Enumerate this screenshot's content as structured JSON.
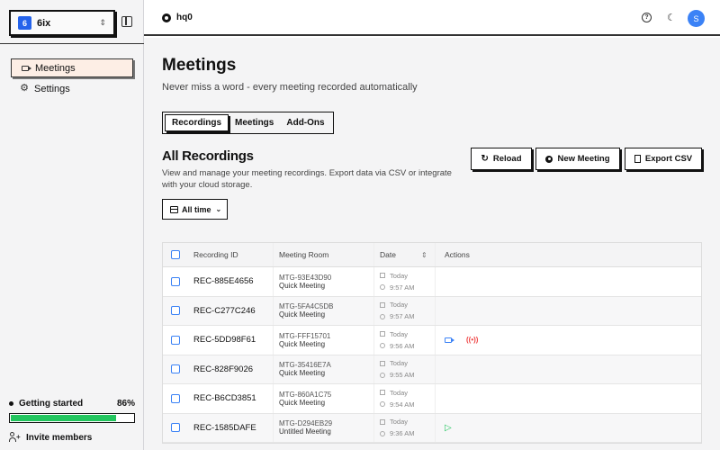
{
  "workspace": {
    "avatar": "6",
    "name": "6ix"
  },
  "sidebar": {
    "items": [
      {
        "label": "Meetings",
        "icon": "video-icon",
        "active": true
      },
      {
        "label": "Settings",
        "icon": "gear-icon",
        "active": false
      }
    ],
    "getting_started": {
      "label": "Getting started",
      "percent_label": "86%",
      "progress": 0.86
    },
    "invite_label": "Invite members"
  },
  "topbar": {
    "brand": "hq0",
    "user_initial": "S"
  },
  "page": {
    "title": "Meetings",
    "subtitle": "Never miss a word - every meeting recorded automatically"
  },
  "tabs": [
    {
      "label": "Recordings",
      "active": true
    },
    {
      "label": "Meetings",
      "active": false
    },
    {
      "label": "Add-Ons",
      "active": false
    }
  ],
  "section": {
    "title": "All Recordings",
    "description": "View and manage your meeting recordings. Export data via CSV or integrate with your cloud storage."
  },
  "toolbar": {
    "reload_label": "Reload",
    "new_meeting_label": "New Meeting",
    "export_label": "Export CSV"
  },
  "filter": {
    "label": "All time"
  },
  "table": {
    "headers": {
      "id": "Recording ID",
      "room": "Meeting Room",
      "date": "Date",
      "actions": "Actions"
    },
    "rows": [
      {
        "id": "REC-885E4656",
        "room_id": "MTG-93E43D90",
        "room_type": "Quick Meeting",
        "day": "Today",
        "time": "9:57 AM",
        "actions": []
      },
      {
        "id": "REC-C277C246",
        "room_id": "MTG-5FA4C5DB",
        "room_type": "Quick Meeting",
        "day": "Today",
        "time": "9:57 AM",
        "actions": []
      },
      {
        "id": "REC-5DD98F61",
        "room_id": "MTG-FFF15701",
        "room_type": "Quick Meeting",
        "day": "Today",
        "time": "9:56 AM",
        "actions": [
          "video",
          "live"
        ]
      },
      {
        "id": "REC-828F9026",
        "room_id": "MTG-35416E7A",
        "room_type": "Quick Meeting",
        "day": "Today",
        "time": "9:55 AM",
        "actions": []
      },
      {
        "id": "REC-B6CD3851",
        "room_id": "MTG-860A1C75",
        "room_type": "Quick Meeting",
        "day": "Today",
        "time": "9:54 AM",
        "actions": []
      },
      {
        "id": "REC-1585DAFE",
        "room_id": "MTG-D294EB29",
        "room_type": "Untitled Meeting",
        "day": "Today",
        "time": "9:36 AM",
        "actions": [
          "play"
        ]
      }
    ]
  },
  "colors": {
    "accent": "#3b82f6",
    "progress": "#22c55e",
    "active_nav": "#fdeee5",
    "live": "#ef4444"
  }
}
